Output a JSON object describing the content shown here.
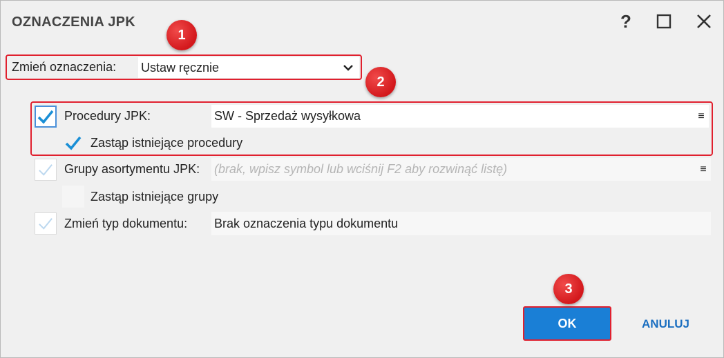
{
  "dialog": {
    "title": "OZNACZENIA JPK",
    "help_label": "?"
  },
  "change": {
    "label": "Zmień oznaczenia:",
    "value": "Ustaw ręcznie"
  },
  "procedures": {
    "label": "Procedury JPK:",
    "value": "SW - Sprzedaż wysyłkowa",
    "checked": true,
    "replace_label": "Zastąp istniejące procedury",
    "replace_checked": true
  },
  "groups": {
    "label": "Grupy asortymentu JPK:",
    "placeholder": "(brak, wpisz symbol lub wciśnij F2 aby rozwinąć listę)",
    "checked": false,
    "replace_label": "Zastąp istniejące grupy",
    "replace_checked": false
  },
  "doctype": {
    "label": "Zmień typ dokumentu:",
    "value": "Brak oznaczenia typu dokumentu",
    "checked": false
  },
  "menu_glyph": "≡",
  "buttons": {
    "ok": "OK",
    "cancel": "ANULUJ"
  },
  "badges": [
    "1",
    "2",
    "3"
  ],
  "colors": {
    "accent": "#1a7fd6",
    "highlight": "#e0202e",
    "check": "#1a8fd6",
    "check_faint": "#bcd8ef"
  }
}
